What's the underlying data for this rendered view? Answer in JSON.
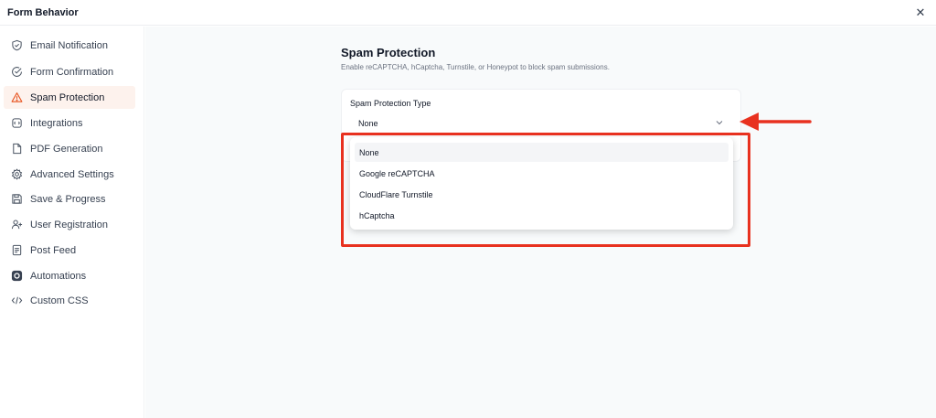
{
  "header": {
    "title": "Form Behavior",
    "close_glyph": "✕"
  },
  "sidebar": {
    "items": [
      {
        "label": "Email Notification",
        "icon": "shield-check-icon"
      },
      {
        "label": "Form Confirmation",
        "icon": "check-circle-icon"
      },
      {
        "label": "Spam Protection",
        "icon": "warning-triangle-icon",
        "active": true
      },
      {
        "label": "Integrations",
        "icon": "integrations-icon"
      },
      {
        "label": "PDF Generation",
        "icon": "document-icon"
      },
      {
        "label": "Advanced Settings",
        "icon": "gear-icon"
      },
      {
        "label": "Save & Progress",
        "icon": "floppy-disk-icon"
      },
      {
        "label": "User Registration",
        "icon": "user-plus-icon"
      },
      {
        "label": "Post Feed",
        "icon": "post-feed-icon"
      },
      {
        "label": "Automations",
        "icon": "automations-icon"
      },
      {
        "label": "Custom CSS",
        "icon": "code-icon"
      }
    ]
  },
  "main": {
    "title": "Spam Protection",
    "description": "Enable reCAPTCHA, hCaptcha, Turnstile, or Honeypot to block spam submissions.",
    "field_label": "Spam Protection Type",
    "selected_value": "None",
    "options": [
      "None",
      "Google reCAPTCHA",
      "CloudFlare Turnstile",
      "hCaptcha"
    ]
  },
  "colors": {
    "accent": "#e8311f",
    "active_bg": "#fdf2ed",
    "warning_icon": "#e8531f",
    "main_bg": "#f8fafb"
  }
}
